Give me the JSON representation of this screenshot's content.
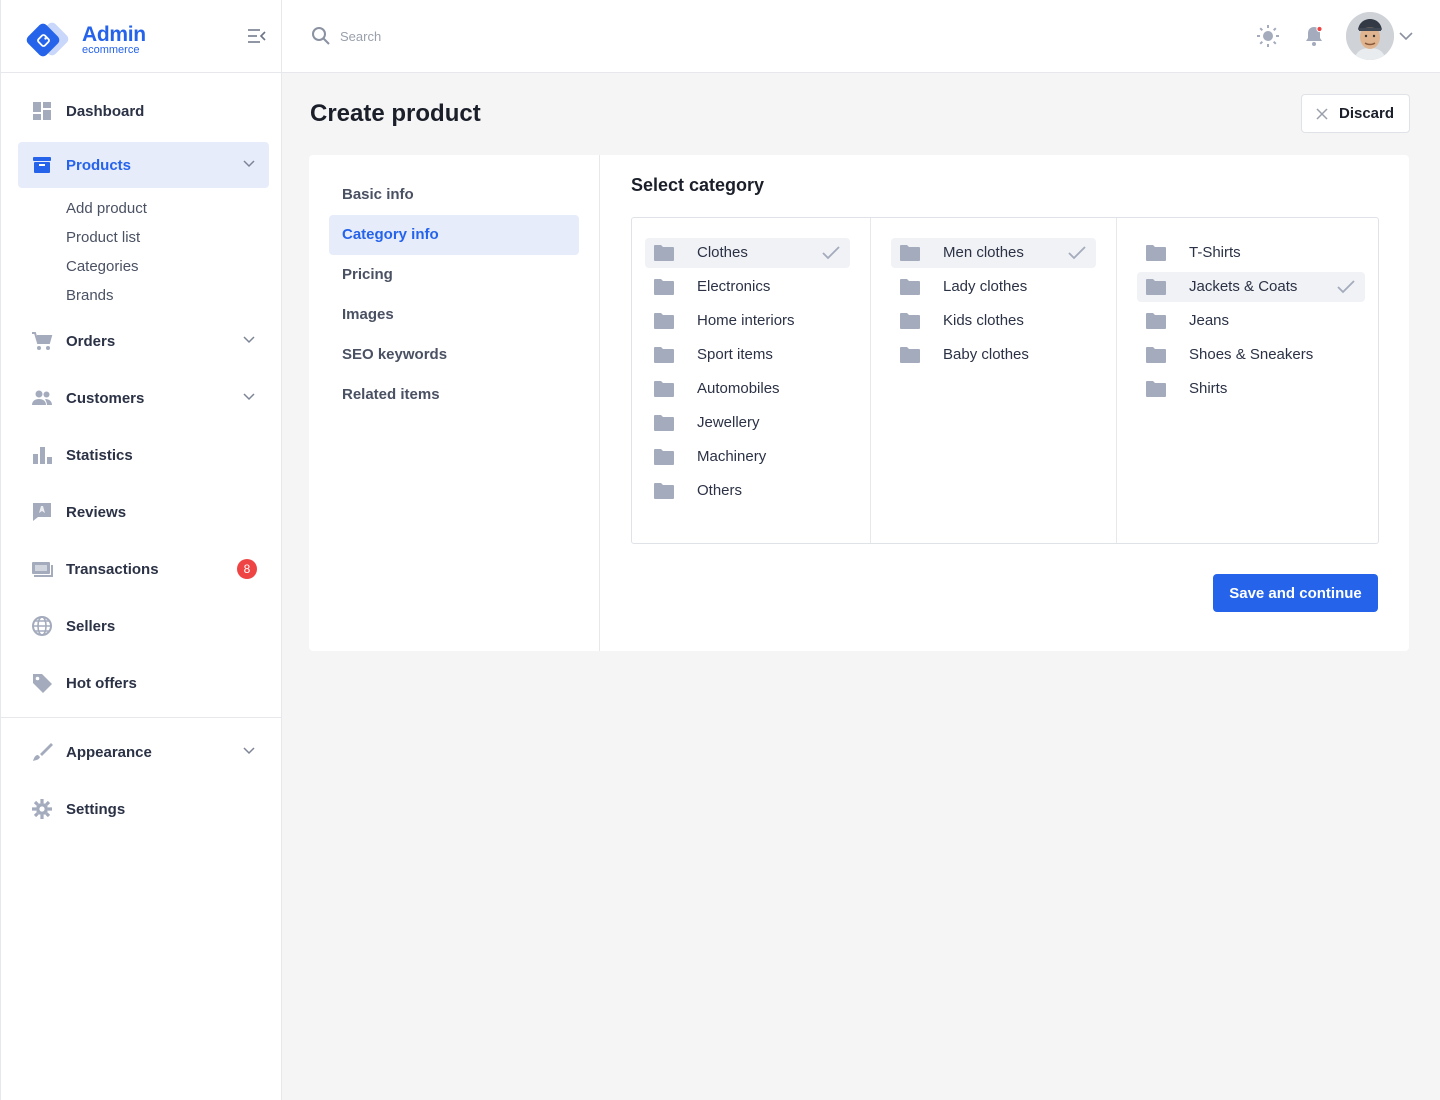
{
  "brand": {
    "title": "Admin",
    "subtitle": "ecommerce"
  },
  "sidebar": {
    "items": [
      {
        "label": "Dashboard",
        "icon": "dashboard-icon"
      },
      {
        "label": "Products",
        "icon": "archive-box-icon",
        "active": true,
        "expanded": true
      },
      {
        "label": "Orders",
        "icon": "cart-icon"
      },
      {
        "label": "Customers",
        "icon": "people-icon"
      },
      {
        "label": "Statistics",
        "icon": "bar-chart-icon"
      },
      {
        "label": "Reviews",
        "icon": "comment-icon"
      },
      {
        "label": "Transactions",
        "icon": "money-icon",
        "badge": "8"
      },
      {
        "label": "Sellers",
        "icon": "globe-icon"
      },
      {
        "label": "Hot offers",
        "icon": "tag-icon"
      },
      {
        "label": "Appearance",
        "icon": "brush-icon"
      },
      {
        "label": "Settings",
        "icon": "gear-icon"
      }
    ],
    "products_sub": [
      "Add product",
      "Product list",
      "Categories",
      "Brands"
    ]
  },
  "header": {
    "search_placeholder": "Search"
  },
  "page": {
    "title": "Create product",
    "discard_label": "Discard",
    "save_label": "Save and continue"
  },
  "steps": [
    "Basic info",
    "Category info",
    "Pricing",
    "Images",
    "SEO keywords",
    "Related items"
  ],
  "active_step": "Category info",
  "category": {
    "title": "Select category",
    "columns": [
      {
        "items": [
          "Clothes",
          "Electronics",
          "Home interiors",
          "Sport items",
          "Automobiles",
          "Jewellery",
          "Machinery",
          "Others"
        ],
        "selected": "Clothes"
      },
      {
        "items": [
          "Men clothes",
          "Lady clothes",
          "Kids clothes",
          "Baby clothes"
        ],
        "selected": "Men clothes"
      },
      {
        "items": [
          "T-Shirts",
          "Jackets & Coats",
          "Jeans",
          "Shoes & Sneakers",
          "Shirts"
        ],
        "selected": "Jackets & Coats"
      }
    ]
  },
  "colors": {
    "accent": "#2563eb",
    "badge": "#ef4444",
    "icon_gray": "#a3abbd",
    "active_bg": "#e7ecfb"
  }
}
